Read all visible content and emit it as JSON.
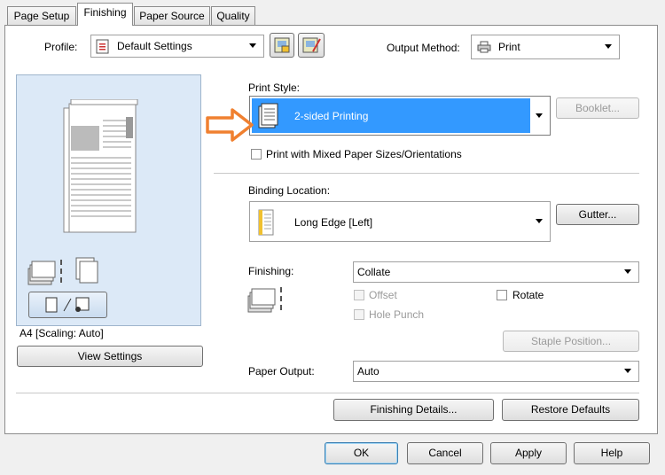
{
  "tabs": [
    {
      "label": "Page Setup"
    },
    {
      "label": "Finishing"
    },
    {
      "label": "Paper Source"
    },
    {
      "label": "Quality"
    }
  ],
  "profile": {
    "label": "Profile:",
    "value": "Default Settings"
  },
  "output_method": {
    "label": "Output Method:",
    "value": "Print"
  },
  "preview": {
    "paper_label": "A4 [Scaling: Auto]",
    "view_settings_label": "View Settings"
  },
  "print_style": {
    "label": "Print Style:",
    "value": "2-sided Printing",
    "booklet_label": "Booklet...",
    "mixed_label": "Print with Mixed Paper Sizes/Orientations"
  },
  "binding": {
    "label": "Binding Location:",
    "value": "Long Edge [Left]",
    "gutter_label": "Gutter..."
  },
  "finishing": {
    "label": "Finishing:",
    "value": "Collate",
    "offset_label": "Offset",
    "rotate_label": "Rotate",
    "hole_punch_label": "Hole Punch",
    "staple_label": "Staple Position..."
  },
  "paper_output": {
    "label": "Paper Output:",
    "value": "Auto"
  },
  "panel_buttons": {
    "finishing_details": "Finishing Details...",
    "restore_defaults": "Restore Defaults"
  },
  "dialog_buttons": {
    "ok": "OK",
    "cancel": "Cancel",
    "apply": "Apply",
    "help": "Help"
  },
  "colors": {
    "highlight": "#3399ff",
    "callout_arrow": "#f08030",
    "preview_bg": "#dce9f7"
  }
}
